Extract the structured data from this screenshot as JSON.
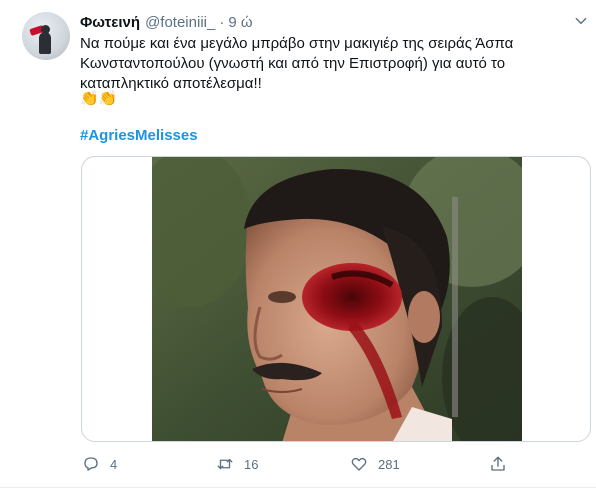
{
  "tweet": {
    "display_name": "Φωτεινή",
    "handle": "@foteiniii_",
    "separator": "·",
    "time": "9 ώ",
    "lines": [
      "Να πούμε και ένα μεγάλο μπράβο στην μακιγιέρ της σειράς Άσπα",
      "Κωνσταντοπούλου (γνωστή και από την Επιστροφή) για αυτό το",
      "καταπληκτικό αποτέλεσμα!!"
    ],
    "emoji": "👏👏",
    "hashtag": "#AgriesMelisses",
    "media": {
      "description_icon": "photo"
    },
    "actions": {
      "reply_count": "4",
      "retweet_count": "16",
      "like_count": "281"
    }
  },
  "colors": {
    "link": "#1b95e0",
    "muted": "#5b7083",
    "text": "#0f1419",
    "border": "#ccd6dd"
  },
  "icons": {
    "reply": "reply-icon",
    "retweet": "retweet-icon",
    "like": "heart-icon",
    "share": "share-icon",
    "more": "chevron-down-icon"
  }
}
